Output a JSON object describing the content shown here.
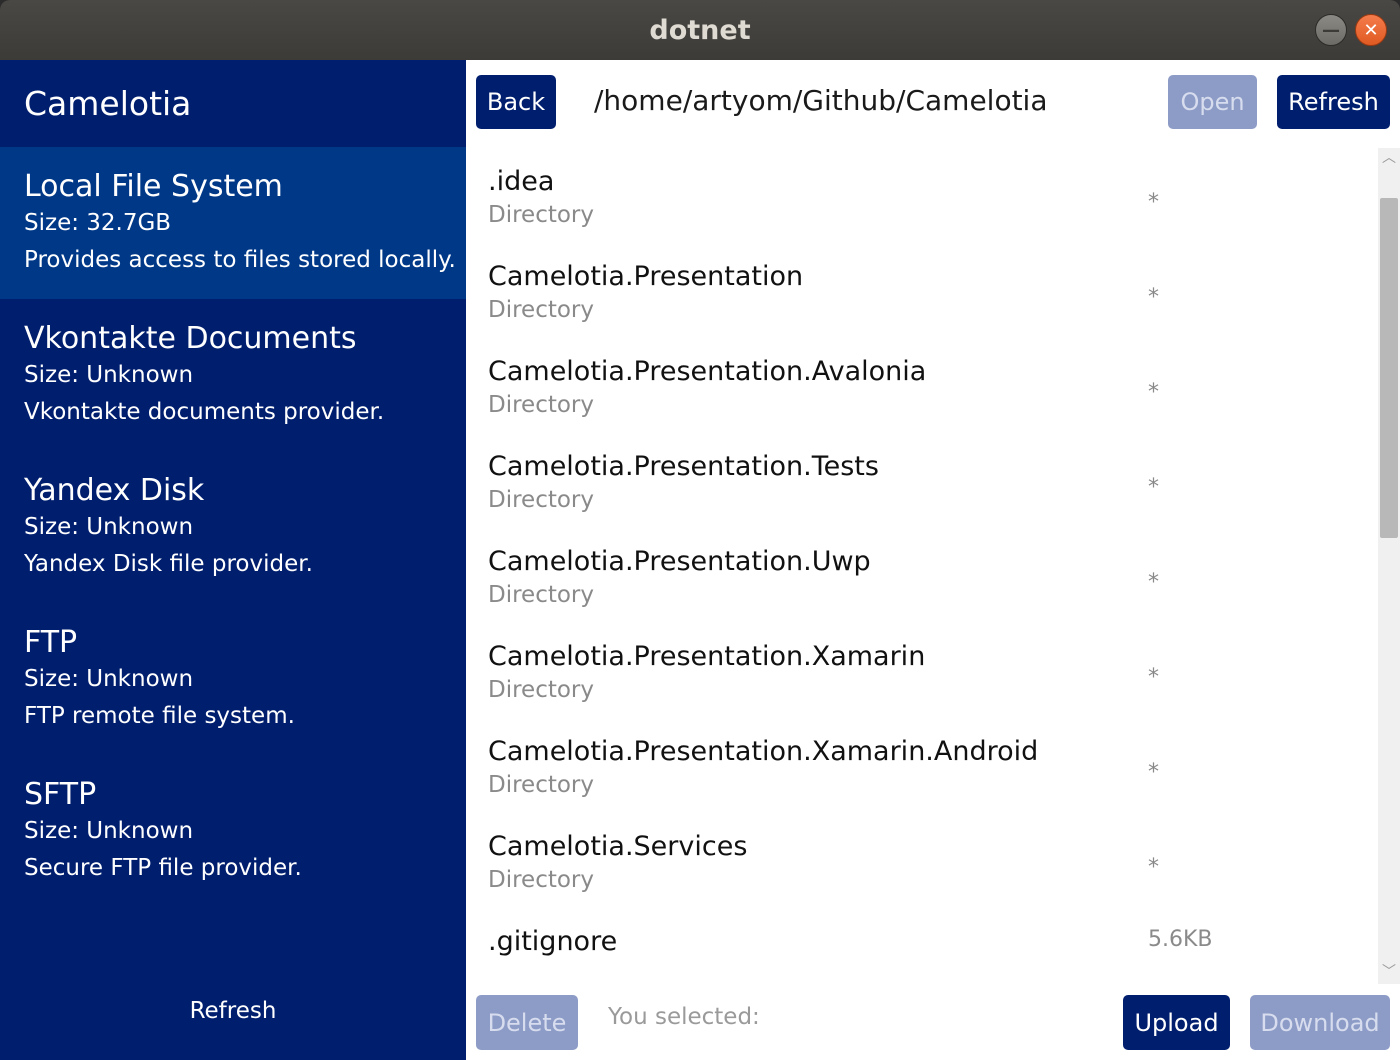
{
  "window": {
    "title": "dotnet",
    "minimize_glyph": "—",
    "close_glyph": "✕"
  },
  "sidebar": {
    "title": "Camelotia",
    "providers": [
      {
        "name": "Local File System",
        "size": "Size: 32.7GB",
        "description": "Provides access to files stored locally.",
        "selected": true
      },
      {
        "name": "Vkontakte Documents",
        "size": "Size: Unknown",
        "description": "Vkontakte documents provider."
      },
      {
        "name": "Yandex Disk",
        "size": "Size: Unknown",
        "description": "Yandex Disk file provider."
      },
      {
        "name": "FTP",
        "size": "Size: Unknown",
        "description": "FTP remote file system."
      },
      {
        "name": "SFTP",
        "size": "Size: Unknown",
        "description": "Secure FTP file provider."
      }
    ],
    "refresh_label": "Refresh"
  },
  "toolbar": {
    "back_label": "Back",
    "path": "/home/artyom/Github/Camelotia",
    "open_label": "Open",
    "refresh_label": "Refresh"
  },
  "files": [
    {
      "name": ".idea",
      "type": "Directory",
      "size": "*"
    },
    {
      "name": "Camelotia.Presentation",
      "type": "Directory",
      "size": "*"
    },
    {
      "name": "Camelotia.Presentation.Avalonia",
      "type": "Directory",
      "size": "*"
    },
    {
      "name": "Camelotia.Presentation.Tests",
      "type": "Directory",
      "size": "*"
    },
    {
      "name": "Camelotia.Presentation.Uwp",
      "type": "Directory",
      "size": "*"
    },
    {
      "name": "Camelotia.Presentation.Xamarin",
      "type": "Directory",
      "size": "*"
    },
    {
      "name": "Camelotia.Presentation.Xamarin.Android",
      "type": "Directory",
      "size": "*"
    },
    {
      "name": "Camelotia.Services",
      "type": "Directory",
      "size": "*"
    },
    {
      "name": ".gitignore",
      "type": "",
      "size": "5.6KB"
    }
  ],
  "scrollbar": {
    "up_glyph": "︿",
    "down_glyph": "﹀"
  },
  "footer": {
    "delete_label": "Delete",
    "selected_label": "You selected:",
    "upload_label": "Upload",
    "download_label": "Download"
  },
  "colors": {
    "sidebar_bg": "#001e6e",
    "sidebar_selected_bg": "#003888",
    "button_bg": "#001e6e",
    "button_disabled_bg": "#8d9cc7"
  }
}
